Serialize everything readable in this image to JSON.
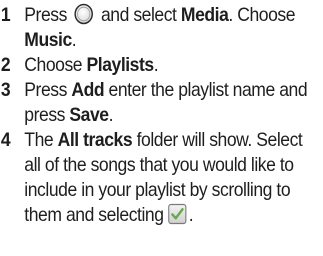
{
  "steps": [
    {
      "number": "1",
      "t1": "Press",
      "t2": "and select",
      "b1": "Media",
      "t3": ". Choose",
      "b2": "Music",
      "t4": "."
    },
    {
      "number": "2",
      "t1": "Choose",
      "b1": "Playlists",
      "t2": "."
    },
    {
      "number": "3",
      "t1": "Press",
      "b1": "Add",
      "t2": "enter the playlist name and press",
      "b2": "Save",
      "t3": "."
    },
    {
      "number": "4",
      "t1": "The",
      "b1": "All tracks",
      "t2": "folder will show. Select all of the songs that you would like to include in your playlist by scrolling to them and selecting",
      "t3": "."
    }
  ],
  "icons": {
    "menu_key": "circle-key-icon",
    "select": "checkbox-checked-icon"
  },
  "colors": {
    "text": "#1e1e1e",
    "step_number": "#1e1e1e",
    "icon_outline": "#2a2a2a",
    "check_green": "#6aa84f"
  }
}
